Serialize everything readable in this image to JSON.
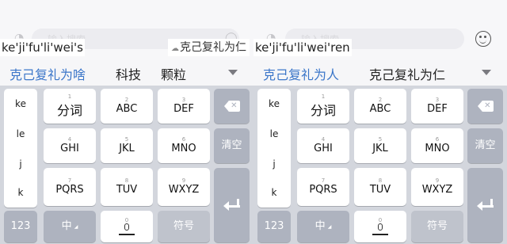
{
  "input_placeholder": "输入搜索",
  "left": {
    "pinyin": "ke'ji'fu'li'wei's",
    "tooltip": "克己复礼为仁",
    "candidates": [
      "克己复礼为啥",
      "科技",
      "颗粒"
    ],
    "side_column": [
      "ke",
      "le",
      "j",
      "k"
    ]
  },
  "right": {
    "pinyin": "ke'ji'fu'li'wei'ren",
    "candidates": [
      "克己复礼为人",
      "克己复礼为仁"
    ],
    "side_column": [
      "ke",
      "le",
      "j",
      "k"
    ]
  },
  "keys": {
    "k1": {
      "num": "1",
      "label": "分词"
    },
    "k2": {
      "num": "2",
      "label": "ABC"
    },
    "k3": {
      "num": "3",
      "label": "DEF"
    },
    "k4": {
      "num": "4",
      "label": "GHI"
    },
    "k5": {
      "num": "5",
      "label": "JKL"
    },
    "k6": {
      "num": "6",
      "label": "MNO"
    },
    "k7": {
      "num": "7",
      "label": "PQRS"
    },
    "k8": {
      "num": "8",
      "label": "TUV"
    },
    "k9": {
      "num": "9",
      "label": "WXYZ"
    },
    "k0": {
      "num": "0"
    },
    "clear": "清空",
    "num_mode": "123",
    "lang": "中",
    "symbol": "符号"
  },
  "icons": [
    "backspace-icon",
    "enter-icon",
    "microphone-icon",
    "smiley-icon",
    "dropdown-caret-icon",
    "cloud-icon"
  ],
  "colors": {
    "candidate_highlight": "#3b76c9",
    "keyboard_bg": "#d3d6dd",
    "function_key": "#aeb3bf"
  }
}
